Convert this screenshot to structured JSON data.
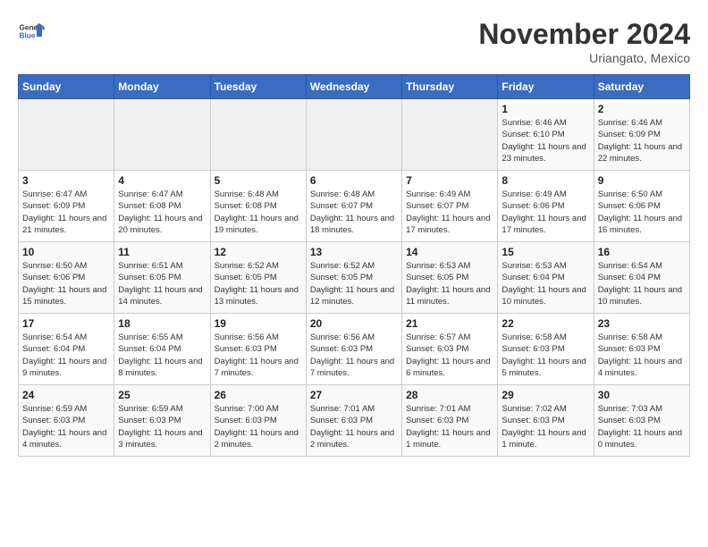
{
  "logo": {
    "general": "General",
    "blue": "Blue"
  },
  "header": {
    "month": "November 2024",
    "location": "Uriangato, Mexico"
  },
  "weekdays": [
    "Sunday",
    "Monday",
    "Tuesday",
    "Wednesday",
    "Thursday",
    "Friday",
    "Saturday"
  ],
  "weeks": [
    [
      {
        "day": "",
        "info": ""
      },
      {
        "day": "",
        "info": ""
      },
      {
        "day": "",
        "info": ""
      },
      {
        "day": "",
        "info": ""
      },
      {
        "day": "",
        "info": ""
      },
      {
        "day": "1",
        "info": "Sunrise: 6:46 AM\nSunset: 6:10 PM\nDaylight: 11 hours and 23 minutes."
      },
      {
        "day": "2",
        "info": "Sunrise: 6:46 AM\nSunset: 6:09 PM\nDaylight: 11 hours and 22 minutes."
      }
    ],
    [
      {
        "day": "3",
        "info": "Sunrise: 6:47 AM\nSunset: 6:09 PM\nDaylight: 11 hours and 21 minutes."
      },
      {
        "day": "4",
        "info": "Sunrise: 6:47 AM\nSunset: 6:08 PM\nDaylight: 11 hours and 20 minutes."
      },
      {
        "day": "5",
        "info": "Sunrise: 6:48 AM\nSunset: 6:08 PM\nDaylight: 11 hours and 19 minutes."
      },
      {
        "day": "6",
        "info": "Sunrise: 6:48 AM\nSunset: 6:07 PM\nDaylight: 11 hours and 18 minutes."
      },
      {
        "day": "7",
        "info": "Sunrise: 6:49 AM\nSunset: 6:07 PM\nDaylight: 11 hours and 17 minutes."
      },
      {
        "day": "8",
        "info": "Sunrise: 6:49 AM\nSunset: 6:06 PM\nDaylight: 11 hours and 17 minutes."
      },
      {
        "day": "9",
        "info": "Sunrise: 6:50 AM\nSunset: 6:06 PM\nDaylight: 11 hours and 16 minutes."
      }
    ],
    [
      {
        "day": "10",
        "info": "Sunrise: 6:50 AM\nSunset: 6:06 PM\nDaylight: 11 hours and 15 minutes."
      },
      {
        "day": "11",
        "info": "Sunrise: 6:51 AM\nSunset: 6:05 PM\nDaylight: 11 hours and 14 minutes."
      },
      {
        "day": "12",
        "info": "Sunrise: 6:52 AM\nSunset: 6:05 PM\nDaylight: 11 hours and 13 minutes."
      },
      {
        "day": "13",
        "info": "Sunrise: 6:52 AM\nSunset: 6:05 PM\nDaylight: 11 hours and 12 minutes."
      },
      {
        "day": "14",
        "info": "Sunrise: 6:53 AM\nSunset: 6:05 PM\nDaylight: 11 hours and 11 minutes."
      },
      {
        "day": "15",
        "info": "Sunrise: 6:53 AM\nSunset: 6:04 PM\nDaylight: 11 hours and 10 minutes."
      },
      {
        "day": "16",
        "info": "Sunrise: 6:54 AM\nSunset: 6:04 PM\nDaylight: 11 hours and 10 minutes."
      }
    ],
    [
      {
        "day": "17",
        "info": "Sunrise: 6:54 AM\nSunset: 6:04 PM\nDaylight: 11 hours and 9 minutes."
      },
      {
        "day": "18",
        "info": "Sunrise: 6:55 AM\nSunset: 6:04 PM\nDaylight: 11 hours and 8 minutes."
      },
      {
        "day": "19",
        "info": "Sunrise: 6:56 AM\nSunset: 6:03 PM\nDaylight: 11 hours and 7 minutes."
      },
      {
        "day": "20",
        "info": "Sunrise: 6:56 AM\nSunset: 6:03 PM\nDaylight: 11 hours and 7 minutes."
      },
      {
        "day": "21",
        "info": "Sunrise: 6:57 AM\nSunset: 6:03 PM\nDaylight: 11 hours and 6 minutes."
      },
      {
        "day": "22",
        "info": "Sunrise: 6:58 AM\nSunset: 6:03 PM\nDaylight: 11 hours and 5 minutes."
      },
      {
        "day": "23",
        "info": "Sunrise: 6:58 AM\nSunset: 6:03 PM\nDaylight: 11 hours and 4 minutes."
      }
    ],
    [
      {
        "day": "24",
        "info": "Sunrise: 6:59 AM\nSunset: 6:03 PM\nDaylight: 11 hours and 4 minutes."
      },
      {
        "day": "25",
        "info": "Sunrise: 6:59 AM\nSunset: 6:03 PM\nDaylight: 11 hours and 3 minutes."
      },
      {
        "day": "26",
        "info": "Sunrise: 7:00 AM\nSunset: 6:03 PM\nDaylight: 11 hours and 2 minutes."
      },
      {
        "day": "27",
        "info": "Sunrise: 7:01 AM\nSunset: 6:03 PM\nDaylight: 11 hours and 2 minutes."
      },
      {
        "day": "28",
        "info": "Sunrise: 7:01 AM\nSunset: 6:03 PM\nDaylight: 11 hours and 1 minute."
      },
      {
        "day": "29",
        "info": "Sunrise: 7:02 AM\nSunset: 6:03 PM\nDaylight: 11 hours and 1 minute."
      },
      {
        "day": "30",
        "info": "Sunrise: 7:03 AM\nSunset: 6:03 PM\nDaylight: 11 hours and 0 minutes."
      }
    ]
  ]
}
